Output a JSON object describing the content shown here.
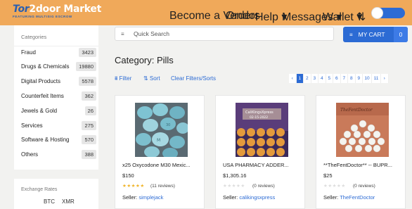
{
  "header": {
    "logo_prefix": "Tor",
    "logo_rest": "2door Market",
    "logo_tagline": "FEATURING MULTISIG ESCROW",
    "nav": [
      {
        "label": "Become a Vendor"
      },
      {
        "label": "Orders"
      },
      {
        "label": "Help ▾"
      },
      {
        "label": "Messages ▾"
      },
      {
        "label": "Wallet ▾"
      },
      {
        "label": "⇅"
      }
    ]
  },
  "sidebar": {
    "title": "Categories",
    "items": [
      {
        "label": "Fraud",
        "count": "3423"
      },
      {
        "label": "Drugs & Chemicals",
        "count": "19880"
      },
      {
        "label": "Digital Products",
        "count": "5578"
      },
      {
        "label": "Counterfeit Items",
        "count": "362"
      },
      {
        "label": "Jewels & Gold",
        "count": "26"
      },
      {
        "label": "Services",
        "count": "275"
      },
      {
        "label": "Software & Hosting",
        "count": "570"
      },
      {
        "label": "Others",
        "count": "388"
      }
    ]
  },
  "exchange": {
    "title": "Exchange Rates",
    "btc": "BTC",
    "xmr": "XMR"
  },
  "search": {
    "icon": "≡",
    "placeholder": "Quick Search"
  },
  "cart": {
    "icon": "≡",
    "label": "MY CART",
    "count": "0"
  },
  "main": {
    "heading": "Category: Pills",
    "filter_label": "⩩ Filter",
    "sort_label": "⇅ Sort",
    "clear_label": "Clear Filters/Sorts"
  },
  "pager": {
    "prev": "‹",
    "pages": [
      "1",
      "2",
      "3",
      "4",
      "5",
      "6",
      "7",
      "8",
      "9",
      "10",
      "11"
    ],
    "next": "›",
    "active": "1"
  },
  "products": [
    {
      "title": "x25 Oxycodone M30 Mexic...",
      "price": "$150",
      "reviews": "(11 reviews)",
      "seller_prefix": "Seller:",
      "seller": "simplejack",
      "stars_filled": 5
    },
    {
      "title": "USA PHARMACY ADDER...",
      "price": "$1,305.16",
      "reviews": "(0 reviews)",
      "seller_prefix": "Seller:",
      "seller": "calikingsxpress",
      "stars_filled": 0
    },
    {
      "title": "**TheFentDoctor** -- BUPR...",
      "price": "$25",
      "reviews": "(0 reviews)",
      "seller_prefix": "Seller:",
      "seller": "TheFentDoctor",
      "stars_filled": 0
    }
  ],
  "colors": {
    "header_bg": "#f0a95a",
    "accent": "#2c6bd4",
    "star_filled": "#f0b428",
    "star_empty": "#dddddd"
  }
}
